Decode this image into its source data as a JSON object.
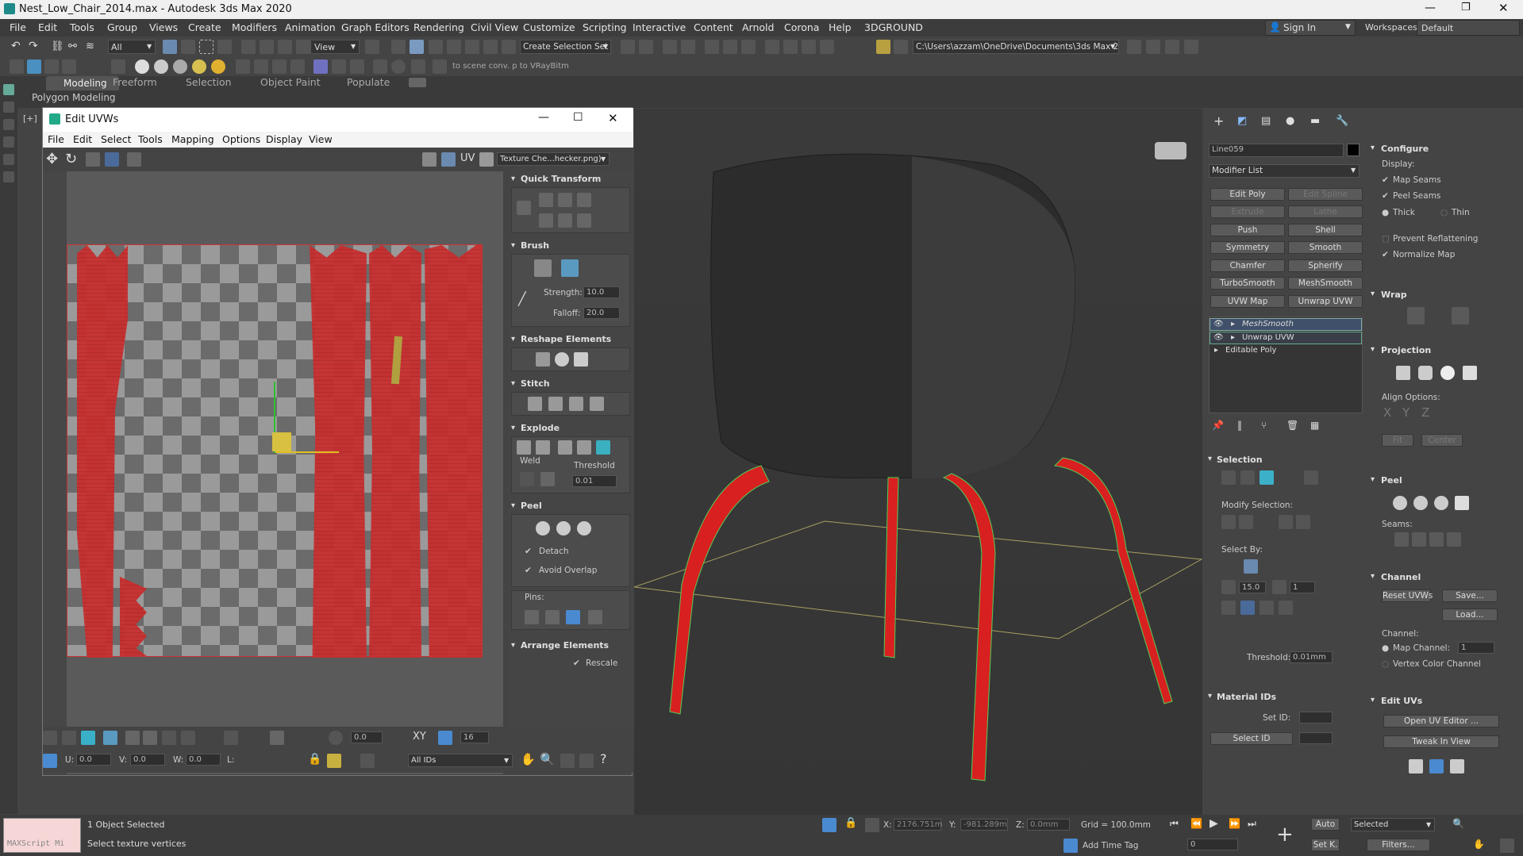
{
  "app": {
    "title": "Nest_Low_Chair_2014.max - Autodesk 3ds Max 2020"
  },
  "menu": [
    "File",
    "Edit",
    "Tools",
    "Group",
    "Views",
    "Create",
    "Modifiers",
    "Animation",
    "Graph Editors",
    "Rendering",
    "Civil View",
    "Customize",
    "Scripting",
    "Interactive",
    "Content",
    "Arnold",
    "Corona",
    "Help",
    "3DGROUND"
  ],
  "account": {
    "sign_in": "Sign In",
    "workspaces_label": "Workspaces:",
    "workspace": "Default"
  },
  "toolbar": {
    "filter": "All",
    "view": "View",
    "selection_set": "Create Selection Set",
    "path": "C:\\Users\\azzam\\OneDrive\\Documents\\3ds Max 2020",
    "scene_conv": "to scene conv. p to VRayBitm"
  },
  "ribbon": {
    "tabs": [
      "Modeling",
      "Freeform",
      "Selection",
      "Object Paint",
      "Populate"
    ],
    "sub": "Polygon Modeling"
  },
  "viewport": {
    "label": "[+]"
  },
  "uv": {
    "title": "Edit UVWs",
    "menu": [
      "File",
      "Edit",
      "Select",
      "Tools",
      "Mapping",
      "Options",
      "Display",
      "View"
    ],
    "uv_label": "UV",
    "texture": "Texture Che...hecker.png)",
    "rollouts": {
      "quick": "Quick Transform",
      "brush": "Brush",
      "strength_label": "Strength:",
      "strength": "10.0",
      "falloff_label": "Falloff:",
      "falloff": "20.0",
      "reshape": "Reshape Elements",
      "stitch": "Stitch",
      "explode": "Explode",
      "weld": "Weld",
      "threshold_label": "Threshold",
      "threshold": "0.01",
      "peel": "Peel",
      "detach": "Detach",
      "avoid": "Avoid Overlap",
      "pins": "Pins:",
      "arrange": "Arrange Elements",
      "rescale": "Rescale"
    },
    "bottom": {
      "spin1": "0.0",
      "spin2": "16",
      "u_label": "U:",
      "u": "0.0",
      "v_label": "V:",
      "v": "0.0",
      "w_label": "W:",
      "w": "0.0",
      "l_label": "L:",
      "ids": "All IDs"
    }
  },
  "cmd": {
    "object": "Line059",
    "modlist": "Modifier List",
    "buttons": [
      [
        "Edit Poly",
        "Edit Spline"
      ],
      [
        "Extrude",
        "Lathe"
      ],
      [
        "Push",
        "Shell"
      ],
      [
        "Symmetry",
        "Smooth"
      ],
      [
        "Chamfer",
        "Spherify"
      ],
      [
        "TurboSmooth",
        "MeshSmooth"
      ],
      [
        "UVW Map",
        "Unwrap UVW"
      ]
    ],
    "stack": [
      "MeshSmooth",
      "Unwrap UVW",
      "Editable Poly"
    ],
    "selection": "Selection",
    "modify_sel": "Modify Selection:",
    "select_by": "Select By:",
    "angle": "15.0",
    "count": "1",
    "threshold_label": "Threshold:",
    "threshold": "0.01mm",
    "matids": "Material IDs",
    "set_id": "Set ID:",
    "select_id": "Select ID"
  },
  "cfg": {
    "configure": "Configure",
    "display": "Display:",
    "map_seams": "Map Seams",
    "peel_seams": "Peel Seams",
    "thick": "Thick",
    "thin": "Thin",
    "prevent": "Prevent Reflattening",
    "normalize": "Normalize Map",
    "wrap": "Wrap",
    "projection": "Projection",
    "align": "Align Options:",
    "fit": "Fit",
    "center": "Center",
    "peel": "Peel",
    "seams": "Seams:",
    "channel": "Channel",
    "reset": "Reset UVWs",
    "save": "Save...",
    "load": "Load...",
    "channel_label": "Channel:",
    "map_channel": "Map Channel:",
    "map_channel_val": "1",
    "vertex_color": "Vertex Color Channel",
    "edit_uvs": "Edit UVs",
    "open_editor": "Open UV Editor ...",
    "tweak": "Tweak In View"
  },
  "status": {
    "script": "MAXScript Mi",
    "selected": "1 Object Selected",
    "prompt": "Select texture vertices",
    "x_label": "X:",
    "x": "2176.751m",
    "y_label": "Y:",
    "y": "-981.289m",
    "z_label": "Z:",
    "z": "0.0mm",
    "grid": "Grid = 100.0mm",
    "auto": "Auto",
    "set_k": "Set K.",
    "key_mode": "Selected",
    "filters": "Filters...",
    "frame": "0",
    "time_tag": "Add Time Tag"
  }
}
